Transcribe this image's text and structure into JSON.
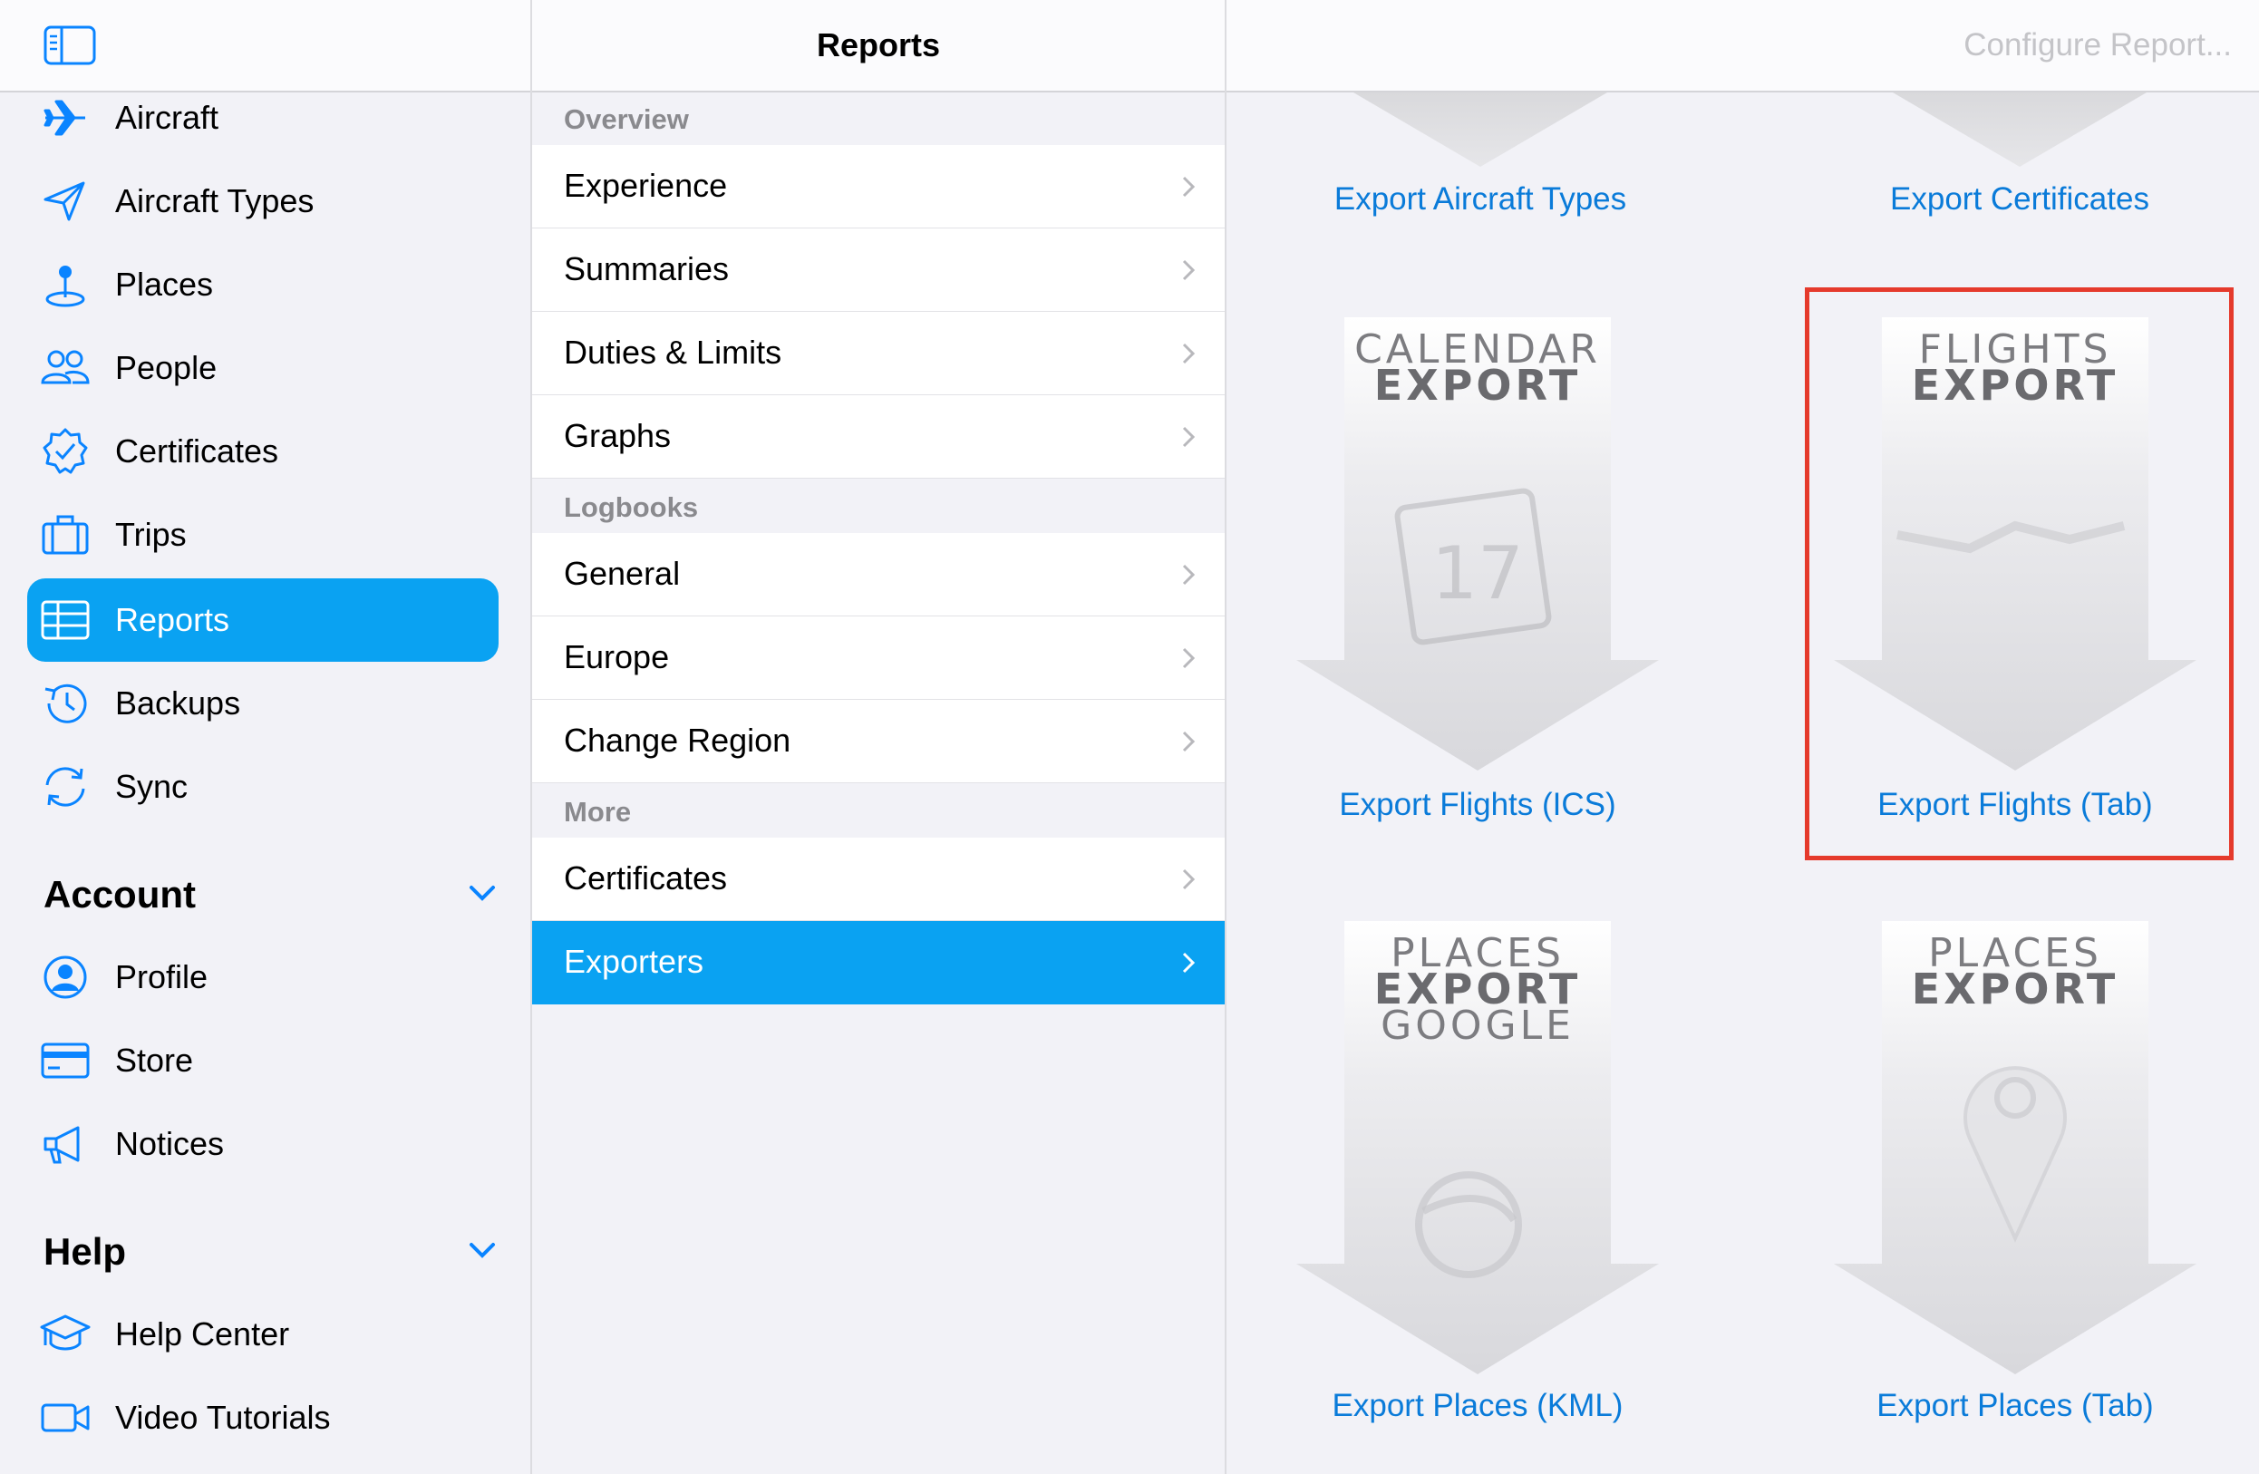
{
  "sidebar": {
    "items": [
      {
        "label": "Aircraft",
        "icon": "airplane-icon"
      },
      {
        "label": "Aircraft Types",
        "icon": "paper-plane-icon"
      },
      {
        "label": "Places",
        "icon": "pin-icon"
      },
      {
        "label": "People",
        "icon": "people-icon"
      },
      {
        "label": "Certificates",
        "icon": "certificate-badge-icon"
      },
      {
        "label": "Trips",
        "icon": "suitcase-icon"
      },
      {
        "label": "Reports",
        "icon": "table-icon",
        "selected": true
      },
      {
        "label": "Backups",
        "icon": "clock-history-icon"
      },
      {
        "label": "Sync",
        "icon": "sync-icon"
      }
    ],
    "account": {
      "title": "Account",
      "items": [
        {
          "label": "Profile",
          "icon": "person-circle-icon"
        },
        {
          "label": "Store",
          "icon": "credit-card-icon"
        },
        {
          "label": "Notices",
          "icon": "megaphone-icon"
        }
      ]
    },
    "help": {
      "title": "Help",
      "items": [
        {
          "label": "Help Center",
          "icon": "graduation-cap-icon"
        },
        {
          "label": "Video Tutorials",
          "icon": "video-icon"
        }
      ]
    }
  },
  "middle": {
    "title": "Reports",
    "groups": [
      {
        "header": "Overview",
        "rows": [
          "Experience",
          "Summaries",
          "Duties & Limits",
          "Graphs"
        ]
      },
      {
        "header": "Logbooks",
        "rows": [
          "General",
          "Europe",
          "Change Region"
        ]
      },
      {
        "header": "More",
        "rows": [
          "Certificates",
          "Exporters"
        ],
        "selected": "Exporters"
      }
    ]
  },
  "right": {
    "configure_label": "Configure Report...",
    "partial_captions": [
      "Export Aircraft Types",
      "Export Certificates"
    ],
    "tiles": [
      {
        "line1": "CALENDAR",
        "line2": "EXPORT",
        "line3": "",
        "caption": "Export Flights (ICS)"
      },
      {
        "line1": "FLIGHTS",
        "line2": "EXPORT",
        "line3": "",
        "caption": "Export Flights (Tab)",
        "highlighted": true
      },
      {
        "line1": "PLACES",
        "line2": "EXPORT",
        "line3": "GOOGLE",
        "caption": "Export Places (KML)"
      },
      {
        "line1": "PLACES",
        "line2": "EXPORT",
        "line3": "",
        "caption": "Export Places (Tab)"
      }
    ]
  },
  "colors": {
    "accent": "#0aa2f2",
    "link": "#0a7bd9",
    "highlight": "#e53a2c"
  }
}
